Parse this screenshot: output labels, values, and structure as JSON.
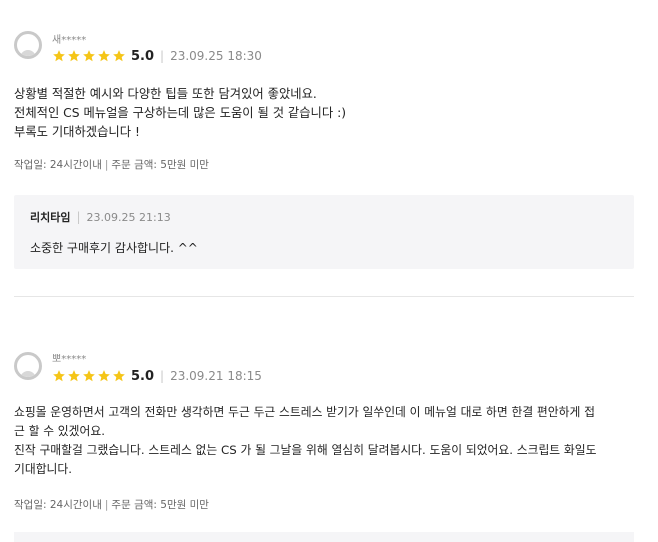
{
  "reviews": [
    {
      "reviewer": "새*****",
      "rating": 5,
      "score": "5.0",
      "date": "23.09.25 18:30",
      "lines": [
        "상황별 적절한 예시와 다양한 팁들 또한 담겨있어 좋았네요.",
        "전체적인 CS 메뉴얼을 구상하는데 많은 도움이 될 것 같습니다 :)",
        "부록도 기대하겠습니다 !"
      ],
      "work_label": "작업일: 24시간이내",
      "order_label": "주문 금액: 5만원 미만",
      "reply": {
        "author": "리치타임",
        "date": "23.09.25 21:13",
        "text": "소중한 구매후기 감사합니다. ^^"
      }
    },
    {
      "reviewer": "뽀*****",
      "rating": 5,
      "score": "5.0",
      "date": "23.09.21 18:15",
      "lines": [
        "쇼핑몰 운영하면서 고객의 전화만 생각하면 두근 두근 스트레스 받기가 일쑤인데 이 메뉴얼 대로 하면 한결 편안하게 접",
        "근 할 수 있겠어요.",
        "진작 구매할걸 그랬습니다. 스트레스 없는 CS 가 될 그날을 위해 열심히 달려봅시다. 도움이 되었어요. 스크립트 화일도",
        "기대합니다."
      ],
      "work_label": "작업일: 24시간이내",
      "order_label": "주문 금액: 5만원 미만"
    }
  ],
  "colors": {
    "star": "#f5c518",
    "reply_bg": "#f5f5f7",
    "divider": "#e6e6e6"
  },
  "icons": {
    "avatar": "default-user-icon",
    "star": "star-icon"
  }
}
